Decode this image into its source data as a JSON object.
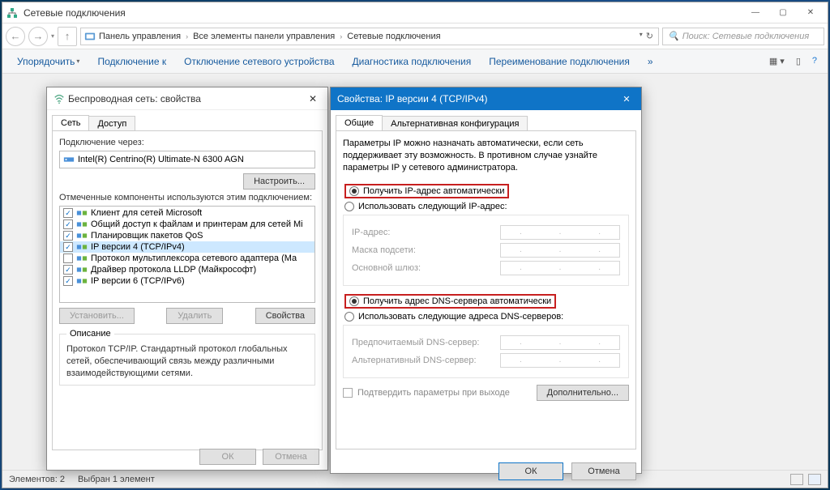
{
  "main": {
    "title": "Сетевые подключения",
    "breadcrumb": {
      "root": "Панель управления",
      "mid": "Все элементы панели управления",
      "leaf": "Сетевые подключения"
    },
    "search_placeholder": "Поиск: Сетевые подключения",
    "toolbar": {
      "organize": "Упорядочить",
      "connect": "Подключение к",
      "disable": "Отключение сетевого устройства",
      "diagnose": "Диагностика подключения",
      "rename": "Переименование подключения"
    },
    "status": {
      "count": "Элементов: 2",
      "selected": "Выбран 1 элемент"
    }
  },
  "dlg1": {
    "title": "Беспроводная сеть: свойства",
    "tabs": {
      "network": "Сеть",
      "access": "Доступ"
    },
    "connect_via_label": "Подключение через:",
    "adapter": "Intel(R) Centrino(R) Ultimate-N 6300 AGN",
    "configure_btn": "Настроить...",
    "components_label": "Отмеченные компоненты используются этим подключением:",
    "components": [
      {
        "checked": true,
        "label": "Клиент для сетей Microsoft"
      },
      {
        "checked": true,
        "label": "Общий доступ к файлам и принтерам для сетей Mi"
      },
      {
        "checked": true,
        "label": "Планировщик пакетов QoS"
      },
      {
        "checked": true,
        "label": "IP версии 4 (TCP/IPv4)",
        "selected": true
      },
      {
        "checked": false,
        "label": "Протокол мультиплексора сетевого адаптера (Ма"
      },
      {
        "checked": true,
        "label": "Драйвер протокола LLDP (Майкрософт)"
      },
      {
        "checked": true,
        "label": "IP версии 6 (TCP/IPv6)"
      }
    ],
    "install_btn": "Установить...",
    "uninstall_btn": "Удалить",
    "properties_btn": "Свойства",
    "desc_legend": "Описание",
    "desc_text": "Протокол TCP/IP. Стандартный протокол глобальных сетей, обеспечивающий связь между различными взаимодействующими сетями.",
    "ok": "ОК",
    "cancel": "Отмена"
  },
  "dlg2": {
    "title": "Свойства: IP версии 4 (TCP/IPv4)",
    "tabs": {
      "general": "Общие",
      "alt": "Альтернативная конфигурация"
    },
    "intro": "Параметры IP можно назначать автоматически, если сеть поддерживает эту возможность. В противном случае узнайте параметры IP у сетевого администратора.",
    "ip_auto": "Получить IP-адрес автоматически",
    "ip_manual": "Использовать следующий IP-адрес:",
    "ip_label": "IP-адрес:",
    "mask_label": "Маска подсети:",
    "gw_label": "Основной шлюз:",
    "dns_auto": "Получить адрес DNS-сервера автоматически",
    "dns_manual": "Использовать следующие адреса DNS-серверов:",
    "dns1_label": "Предпочитаемый DNS-сервер:",
    "dns2_label": "Альтернативный DNS-сервер:",
    "confirm_on_exit": "Подтвердить параметры при выходе",
    "advanced_btn": "Дополнительно...",
    "ok": "ОК",
    "cancel": "Отмена"
  }
}
